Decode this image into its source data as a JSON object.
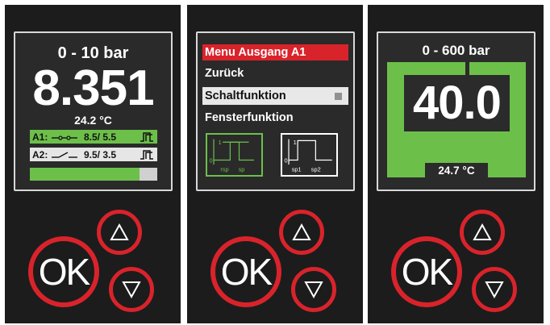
{
  "panels": [
    {
      "range": "0 - 10 bar",
      "value": "8.351",
      "temperature": "24.2 °C",
      "outputs": [
        {
          "label": "A1:",
          "values": "8.5/ 5.5"
        },
        {
          "label": "A2:",
          "values": "9.5/ 3.5"
        }
      ],
      "bar_level_percent": 86,
      "ok_label": "OK"
    },
    {
      "menu_title": "Menu Ausgang A1",
      "items": [
        "Zurück",
        "Schaltfunktion",
        "Fensterfunktion"
      ],
      "diagram1": {
        "high": "1",
        "low": "0",
        "labels": [
          "rsp",
          "sp"
        ]
      },
      "diagram2": {
        "high": "1",
        "low": "0",
        "labels": [
          "sp1",
          "sp2"
        ]
      },
      "ok_label": "OK"
    },
    {
      "range": "0 - 600 bar",
      "value": "40.0",
      "temperature": "24.7 °C",
      "ok_label": "OK"
    }
  ],
  "colors": {
    "accent_red": "#d9232b",
    "status_green": "#6cc04a",
    "panel_bg": "#1c1c1c"
  },
  "icons": [
    "up-arrow-icon",
    "down-arrow-icon",
    "switch-no-icon",
    "switch-nc-icon",
    "hysteresis-icon"
  ]
}
